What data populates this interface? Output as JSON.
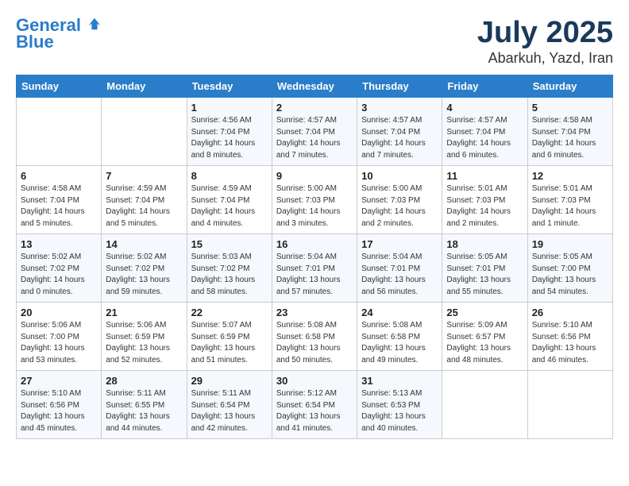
{
  "header": {
    "logo_line1": "General",
    "logo_line2": "Blue",
    "title": "July 2025",
    "subtitle": "Abarkuh, Yazd, Iran"
  },
  "days_of_week": [
    "Sunday",
    "Monday",
    "Tuesday",
    "Wednesday",
    "Thursday",
    "Friday",
    "Saturday"
  ],
  "weeks": [
    [
      {
        "day": "",
        "sunrise": "",
        "sunset": "",
        "daylight": ""
      },
      {
        "day": "",
        "sunrise": "",
        "sunset": "",
        "daylight": ""
      },
      {
        "day": "1",
        "sunrise": "Sunrise: 4:56 AM",
        "sunset": "Sunset: 7:04 PM",
        "daylight": "Daylight: 14 hours and 8 minutes."
      },
      {
        "day": "2",
        "sunrise": "Sunrise: 4:57 AM",
        "sunset": "Sunset: 7:04 PM",
        "daylight": "Daylight: 14 hours and 7 minutes."
      },
      {
        "day": "3",
        "sunrise": "Sunrise: 4:57 AM",
        "sunset": "Sunset: 7:04 PM",
        "daylight": "Daylight: 14 hours and 7 minutes."
      },
      {
        "day": "4",
        "sunrise": "Sunrise: 4:57 AM",
        "sunset": "Sunset: 7:04 PM",
        "daylight": "Daylight: 14 hours and 6 minutes."
      },
      {
        "day": "5",
        "sunrise": "Sunrise: 4:58 AM",
        "sunset": "Sunset: 7:04 PM",
        "daylight": "Daylight: 14 hours and 6 minutes."
      }
    ],
    [
      {
        "day": "6",
        "sunrise": "Sunrise: 4:58 AM",
        "sunset": "Sunset: 7:04 PM",
        "daylight": "Daylight: 14 hours and 5 minutes."
      },
      {
        "day": "7",
        "sunrise": "Sunrise: 4:59 AM",
        "sunset": "Sunset: 7:04 PM",
        "daylight": "Daylight: 14 hours and 5 minutes."
      },
      {
        "day": "8",
        "sunrise": "Sunrise: 4:59 AM",
        "sunset": "Sunset: 7:04 PM",
        "daylight": "Daylight: 14 hours and 4 minutes."
      },
      {
        "day": "9",
        "sunrise": "Sunrise: 5:00 AM",
        "sunset": "Sunset: 7:03 PM",
        "daylight": "Daylight: 14 hours and 3 minutes."
      },
      {
        "day": "10",
        "sunrise": "Sunrise: 5:00 AM",
        "sunset": "Sunset: 7:03 PM",
        "daylight": "Daylight: 14 hours and 2 minutes."
      },
      {
        "day": "11",
        "sunrise": "Sunrise: 5:01 AM",
        "sunset": "Sunset: 7:03 PM",
        "daylight": "Daylight: 14 hours and 2 minutes."
      },
      {
        "day": "12",
        "sunrise": "Sunrise: 5:01 AM",
        "sunset": "Sunset: 7:03 PM",
        "daylight": "Daylight: 14 hours and 1 minute."
      }
    ],
    [
      {
        "day": "13",
        "sunrise": "Sunrise: 5:02 AM",
        "sunset": "Sunset: 7:02 PM",
        "daylight": "Daylight: 14 hours and 0 minutes."
      },
      {
        "day": "14",
        "sunrise": "Sunrise: 5:02 AM",
        "sunset": "Sunset: 7:02 PM",
        "daylight": "Daylight: 13 hours and 59 minutes."
      },
      {
        "day": "15",
        "sunrise": "Sunrise: 5:03 AM",
        "sunset": "Sunset: 7:02 PM",
        "daylight": "Daylight: 13 hours and 58 minutes."
      },
      {
        "day": "16",
        "sunrise": "Sunrise: 5:04 AM",
        "sunset": "Sunset: 7:01 PM",
        "daylight": "Daylight: 13 hours and 57 minutes."
      },
      {
        "day": "17",
        "sunrise": "Sunrise: 5:04 AM",
        "sunset": "Sunset: 7:01 PM",
        "daylight": "Daylight: 13 hours and 56 minutes."
      },
      {
        "day": "18",
        "sunrise": "Sunrise: 5:05 AM",
        "sunset": "Sunset: 7:01 PM",
        "daylight": "Daylight: 13 hours and 55 minutes."
      },
      {
        "day": "19",
        "sunrise": "Sunrise: 5:05 AM",
        "sunset": "Sunset: 7:00 PM",
        "daylight": "Daylight: 13 hours and 54 minutes."
      }
    ],
    [
      {
        "day": "20",
        "sunrise": "Sunrise: 5:06 AM",
        "sunset": "Sunset: 7:00 PM",
        "daylight": "Daylight: 13 hours and 53 minutes."
      },
      {
        "day": "21",
        "sunrise": "Sunrise: 5:06 AM",
        "sunset": "Sunset: 6:59 PM",
        "daylight": "Daylight: 13 hours and 52 minutes."
      },
      {
        "day": "22",
        "sunrise": "Sunrise: 5:07 AM",
        "sunset": "Sunset: 6:59 PM",
        "daylight": "Daylight: 13 hours and 51 minutes."
      },
      {
        "day": "23",
        "sunrise": "Sunrise: 5:08 AM",
        "sunset": "Sunset: 6:58 PM",
        "daylight": "Daylight: 13 hours and 50 minutes."
      },
      {
        "day": "24",
        "sunrise": "Sunrise: 5:08 AM",
        "sunset": "Sunset: 6:58 PM",
        "daylight": "Daylight: 13 hours and 49 minutes."
      },
      {
        "day": "25",
        "sunrise": "Sunrise: 5:09 AM",
        "sunset": "Sunset: 6:57 PM",
        "daylight": "Daylight: 13 hours and 48 minutes."
      },
      {
        "day": "26",
        "sunrise": "Sunrise: 5:10 AM",
        "sunset": "Sunset: 6:56 PM",
        "daylight": "Daylight: 13 hours and 46 minutes."
      }
    ],
    [
      {
        "day": "27",
        "sunrise": "Sunrise: 5:10 AM",
        "sunset": "Sunset: 6:56 PM",
        "daylight": "Daylight: 13 hours and 45 minutes."
      },
      {
        "day": "28",
        "sunrise": "Sunrise: 5:11 AM",
        "sunset": "Sunset: 6:55 PM",
        "daylight": "Daylight: 13 hours and 44 minutes."
      },
      {
        "day": "29",
        "sunrise": "Sunrise: 5:11 AM",
        "sunset": "Sunset: 6:54 PM",
        "daylight": "Daylight: 13 hours and 42 minutes."
      },
      {
        "day": "30",
        "sunrise": "Sunrise: 5:12 AM",
        "sunset": "Sunset: 6:54 PM",
        "daylight": "Daylight: 13 hours and 41 minutes."
      },
      {
        "day": "31",
        "sunrise": "Sunrise: 5:13 AM",
        "sunset": "Sunset: 6:53 PM",
        "daylight": "Daylight: 13 hours and 40 minutes."
      },
      {
        "day": "",
        "sunrise": "",
        "sunset": "",
        "daylight": ""
      },
      {
        "day": "",
        "sunrise": "",
        "sunset": "",
        "daylight": ""
      }
    ]
  ]
}
